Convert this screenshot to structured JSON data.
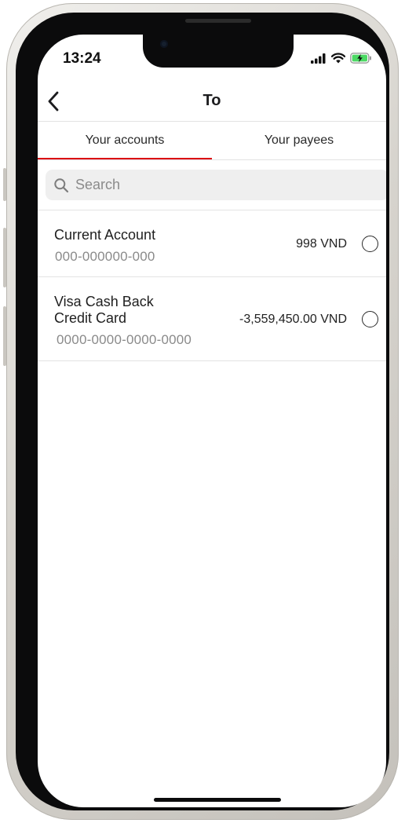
{
  "status_bar": {
    "time": "13:24",
    "icons": [
      "signal-icon",
      "wifi-icon",
      "battery-charging-icon"
    ],
    "battery_color": "#4cd964"
  },
  "nav": {
    "back_icon": "chevron-left-icon",
    "title": "To"
  },
  "tabs": [
    {
      "label": "Your accounts",
      "active": true
    },
    {
      "label": "Your payees",
      "active": false
    }
  ],
  "accent_color": "#db0011",
  "search": {
    "placeholder": "Search",
    "value": "",
    "icon": "search-icon"
  },
  "accounts": [
    {
      "name": "Current Account",
      "number": "000-000000-000",
      "balance": "998 VND",
      "selected": false
    },
    {
      "name": "Visa Cash Back Credit Card",
      "number": "0000-0000-0000-0000",
      "balance": "-3,559,450.00 VND",
      "selected": false
    }
  ]
}
